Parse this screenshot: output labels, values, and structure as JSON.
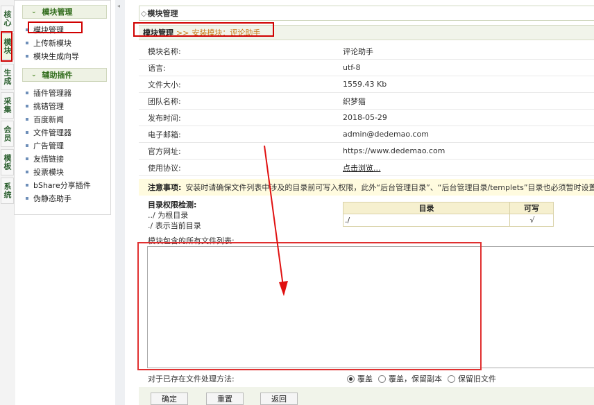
{
  "vtabs": [
    "核心",
    "模块",
    "生成",
    "采集",
    "会员",
    "模板",
    "系统"
  ],
  "sidebar": {
    "sections": [
      {
        "title": "模块管理",
        "items": [
          "模块管理",
          "上传新模块",
          "模块生成向导"
        ]
      },
      {
        "title": "辅助插件",
        "items": [
          "插件管理器",
          "挑错管理",
          "百度新闻",
          "文件管理器",
          "广告管理",
          "友情链接",
          "投票模块",
          "bShare分享插件",
          "伪静态助手"
        ]
      }
    ]
  },
  "main": {
    "title": "模块管理",
    "breadcrumb": {
      "root": "模块管理",
      "sep": ">>",
      "page": "安装模块：评论助手"
    },
    "info_rows": [
      {
        "label": "模块名称:",
        "value": "评论助手"
      },
      {
        "label": "语言:",
        "value": "utf-8"
      },
      {
        "label": "文件大小:",
        "value": "1559.43 Kb"
      },
      {
        "label": "团队名称:",
        "value": "织梦猫"
      },
      {
        "label": "发布时间:",
        "value": "2018-05-29"
      },
      {
        "label": "电子邮箱:",
        "value": "admin@dedemao.com"
      },
      {
        "label": "官方网址:",
        "value": "https://www.dedemao.com"
      },
      {
        "label": "使用协议:",
        "value": "点击浏览..."
      }
    ],
    "notice": {
      "label": "注意事项:",
      "text": "安装时请确保文件列表中涉及的目录前可写入权限，此外“后台管理目录”、“后台管理目录/templets”目录也必须暂时设置可"
    },
    "permissions": {
      "title": "目录权限检测:",
      "lines": [
        "../ 为根目录",
        "./ 表示当前目录"
      ],
      "headers": [
        "目录",
        "可写"
      ],
      "rows": [
        {
          "dir": "./",
          "writable": "√"
        }
      ]
    },
    "files_label": "模块包含的所有文件列表:",
    "existing_files": {
      "label": "对于已存在文件处理方法:",
      "options": [
        "覆盖",
        "覆盖，保留副本",
        "保留旧文件"
      ],
      "selected": 0
    },
    "buttons": {
      "confirm": "确定",
      "reset": "重置",
      "back": "返回"
    }
  }
}
